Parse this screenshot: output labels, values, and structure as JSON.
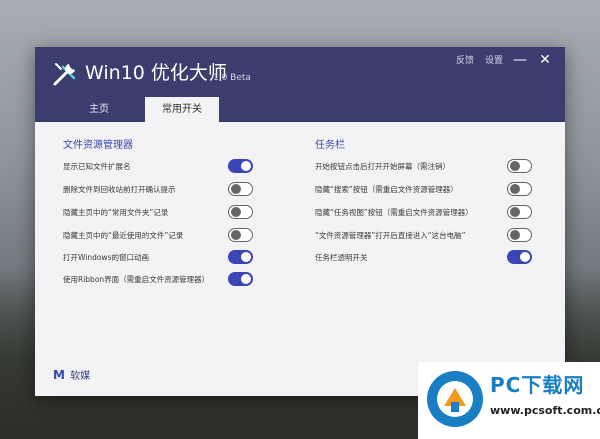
{
  "app": {
    "title": "Win10 优化大师",
    "version": "1.0 Beta",
    "links": {
      "feedback": "反馈",
      "settings": "设置"
    },
    "minimize_glyph": "—",
    "close_glyph": "✕",
    "brand_mark": "M",
    "brand_name": "软媒"
  },
  "tabs": [
    {
      "label": "主页",
      "active": false
    },
    {
      "label": "常用开关",
      "active": true
    }
  ],
  "sections": {
    "explorer": {
      "title": "文件资源管理器",
      "items": [
        {
          "label": "显示已知文件扩展名",
          "on": true
        },
        {
          "label": "删除文件到回收站前打开确认提示",
          "on": false
        },
        {
          "label": "隐藏主页中的“常用文件夹”记录",
          "on": false
        },
        {
          "label": "隐藏主页中的“最近使用的文件”记录",
          "on": false
        },
        {
          "label": "打开Windows的窗口动画",
          "on": true
        },
        {
          "label": "使用Ribbon界面（需重启文件资源管理器）",
          "on": true
        }
      ]
    },
    "taskbar": {
      "title": "任务栏",
      "items": [
        {
          "label": "开始按钮点击后打开开始屏幕（需注销）",
          "on": false
        },
        {
          "label": "隐藏“搜索”按钮（需重启文件资源管理器）",
          "on": false
        },
        {
          "label": "隐藏“任务视图”按钮（需重启文件资源管理器）",
          "on": false
        },
        {
          "label": "“文件资源管理器”打开后直接进入“这台电脑”",
          "on": false
        },
        {
          "label": "任务栏透明开关",
          "on": true
        }
      ]
    }
  },
  "watermark": {
    "title": "PC下载网",
    "url": "www.pcsoft.com.cn"
  },
  "colors": {
    "header": "#3b3d6e",
    "accent": "#3b45b8",
    "section_title": "#3b4aa8"
  }
}
